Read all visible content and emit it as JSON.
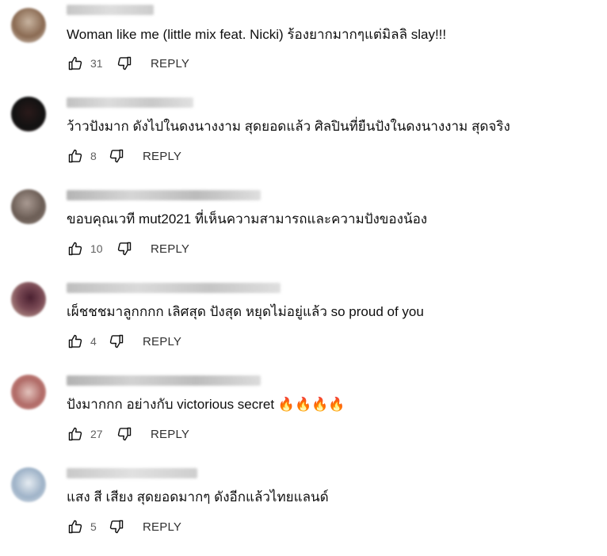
{
  "comments": [
    {
      "text": "Woman like me (little mix feat. Nicki) ร้องยากมากๆแต่มิลลิ slay!!!",
      "likes": "31",
      "reply_label": "REPLY",
      "avatar_colors": [
        "#8a6a52",
        "#c8b4a0"
      ]
    },
    {
      "text": "ว้าวปังมาก ดังไปในดงนางงาม สุดยอดแล้ว ศิลปินที่ยืนปังในดงนางงาม สุดจริง",
      "likes": "8",
      "reply_label": "REPLY",
      "avatar_colors": [
        "#111111",
        "#3a2a2a"
      ]
    },
    {
      "text": "ขอบคุณเวที mut2021 ที่เห็นความสามารถและความปังของน้อง",
      "likes": "10",
      "reply_label": "REPLY",
      "avatar_colors": [
        "#6b5d55",
        "#a99a92"
      ]
    },
    {
      "text": "เผ็ชชชมาลูกกกก เลิศสุด ปังสุด หยุดไม่อยู่แล้ว so proud of you",
      "likes": "4",
      "reply_label": "REPLY",
      "avatar_colors": [
        "#4a2030",
        "#c9a99a"
      ]
    },
    {
      "text": "ปังมากกก อย่างกับ victorious secret 🔥🔥🔥🔥",
      "likes": "27",
      "reply_label": "REPLY",
      "avatar_colors": [
        "#b06a66",
        "#e3c3bd"
      ]
    },
    {
      "text": "แสง สี เสียง สุดยอดมากๆ ดังอีกแล้วไทยแลนด์",
      "likes": "5",
      "reply_label": "REPLY",
      "avatar_colors": [
        "#9fb3c8",
        "#e6ecf2"
      ]
    }
  ]
}
